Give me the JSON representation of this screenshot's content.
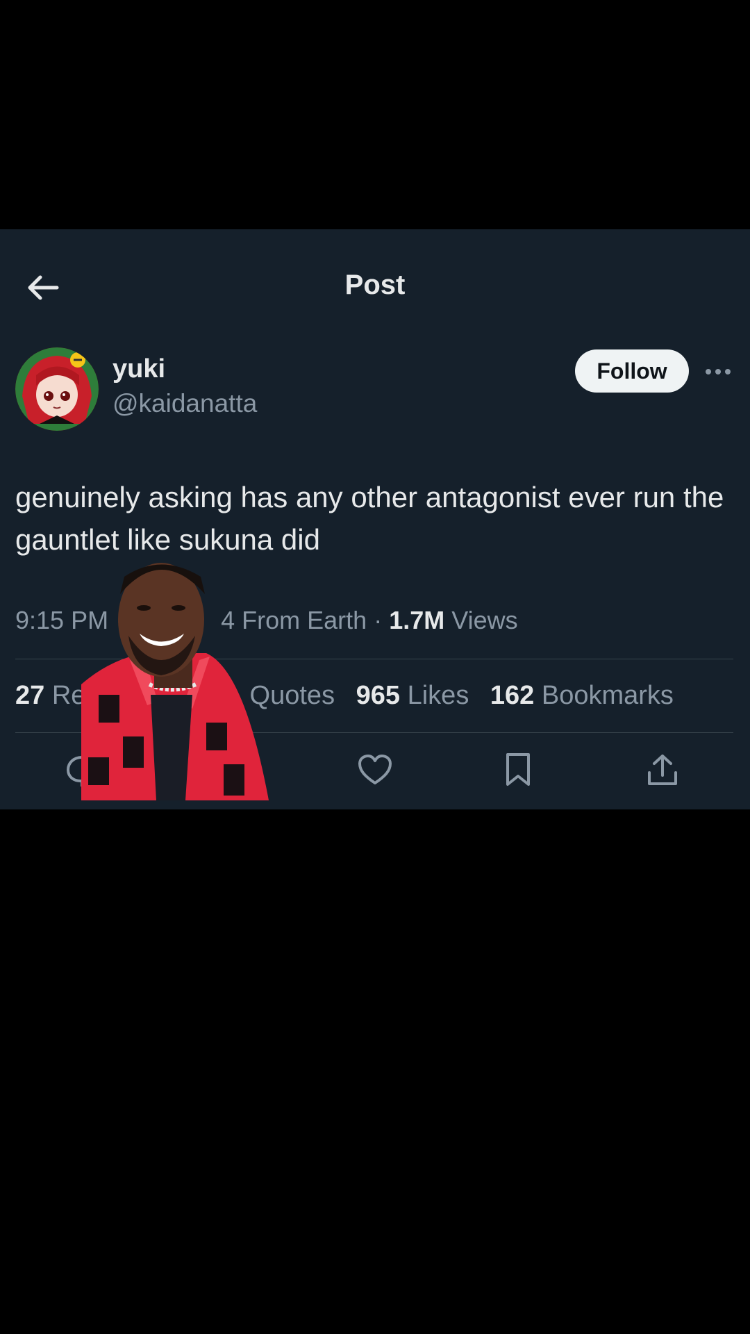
{
  "header": {
    "title": "Post",
    "back_icon": "arrow-left-icon"
  },
  "author": {
    "name": "yuki",
    "handle": "@kaidanatta",
    "follow_label": "Follow"
  },
  "tweet": {
    "text": "genuinely asking has any other antagonist ever run the gauntlet like sukuna did"
  },
  "meta": {
    "time": "9:15 PM",
    "sep": "·",
    "source_partial": "4 From Earth",
    "views_count": "1.7M",
    "views_label": "Views"
  },
  "stats": [
    {
      "count": "27",
      "label": "Re"
    },
    {
      "count": "",
      "label": "Quotes"
    },
    {
      "count": "965",
      "label": "Likes"
    },
    {
      "count": "162",
      "label": "Bookmarks"
    }
  ],
  "actions": [
    "reply-icon",
    "like-icon",
    "bookmark-icon",
    "share-icon"
  ],
  "colors": {
    "background": "#15202b",
    "text": "#e7e9ea",
    "secondary": "#8b98a5",
    "divider": "#38444d"
  }
}
